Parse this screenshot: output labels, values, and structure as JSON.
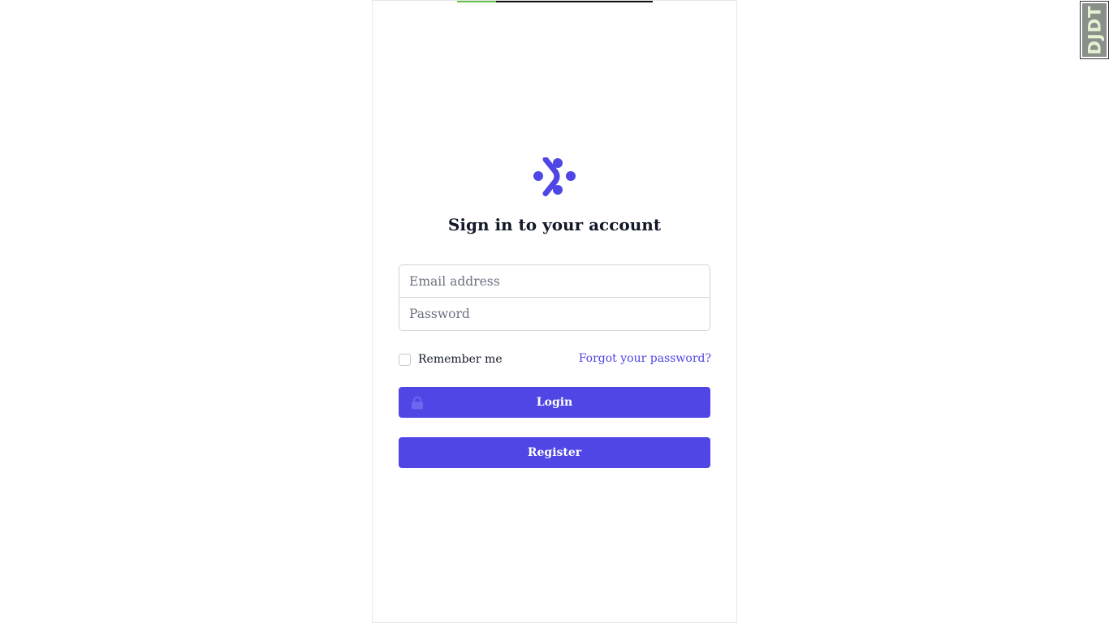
{
  "page": {
    "title": "Sign in to your account",
    "loading_progress": 0.2
  },
  "form": {
    "email_placeholder": "Email address",
    "password_placeholder": "Password",
    "remember_label": "Remember me",
    "remember_checked": false,
    "forgot_link": "Forgot your password?",
    "login_label": "Login",
    "register_label": "Register"
  },
  "toolbar": {
    "djdt_label": "DJDT"
  },
  "icons": {
    "logo": "brand-logo-icon",
    "lock": "lock-icon"
  },
  "colors": {
    "accent": "#4f46e5",
    "progress": "#6ac14a"
  }
}
